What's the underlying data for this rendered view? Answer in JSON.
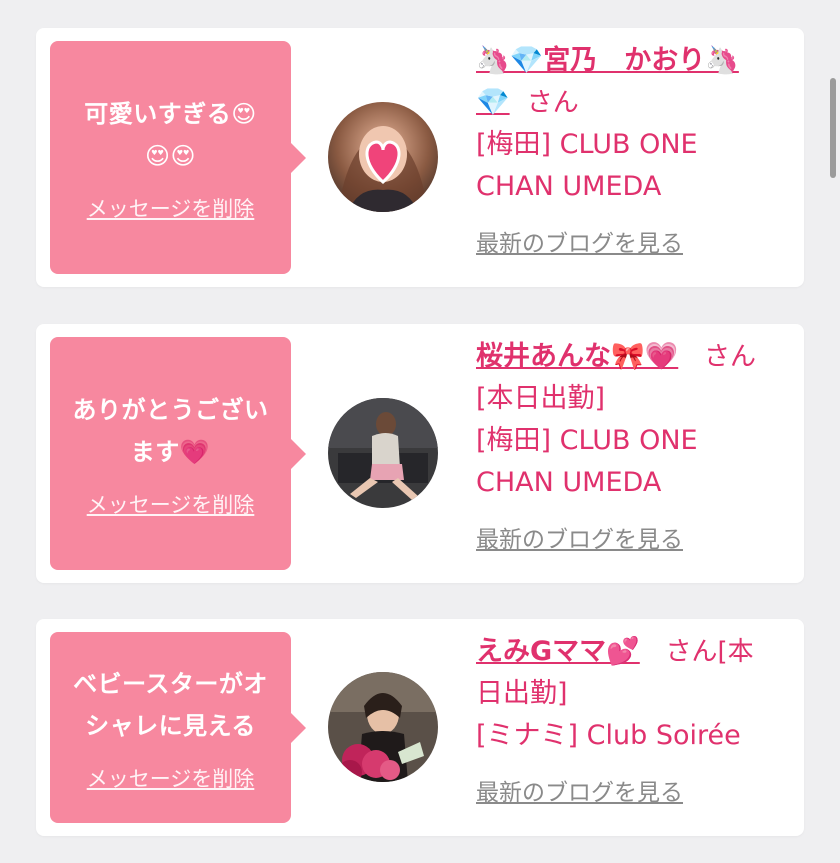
{
  "colors": {
    "background": "#efeff1",
    "card": "#ffffff",
    "bubble": "#f7889f",
    "accent": "#e0316d",
    "link_gray": "#8a8a8a"
  },
  "cards": [
    {
      "message_text": "可愛いすぎる😍",
      "message_emojis": "😍😍",
      "delete_label": "メッセージを削除",
      "name": "🦄💎宮乃　かおり🦄",
      "name_cont": "💎",
      "suffix": "さん",
      "status": "",
      "shop": "[梅田] CLUB ONE",
      "shop_cont": "CHAN UMEDA",
      "blog_label": "最新のブログを見る",
      "avatar_icon": "heart-sticker-portrait"
    },
    {
      "message_text": "ありがとうござい",
      "message_emojis": "ます💗",
      "delete_label": "メッセージを削除",
      "name": "桜井あんな🎀💗",
      "name_cont": "",
      "suffix": "さん",
      "status": "[本日出勤]",
      "shop": "[梅田] CLUB ONE",
      "shop_cont": "CHAN UMEDA",
      "blog_label": "最新のブログを見る",
      "avatar_icon": "seated-woman-portrait"
    },
    {
      "message_text": "ベビースターがオ",
      "message_emojis": "シャレに見える",
      "delete_label": "メッセージを削除",
      "name": "えみGママ💕",
      "name_cont": "",
      "suffix": "さん[本",
      "status": "日出勤]",
      "shop": "[ミナミ] Club Soirée",
      "shop_cont": "",
      "blog_label": "最新のブログを見る",
      "avatar_icon": "woman-with-bouquet-portrait"
    }
  ]
}
